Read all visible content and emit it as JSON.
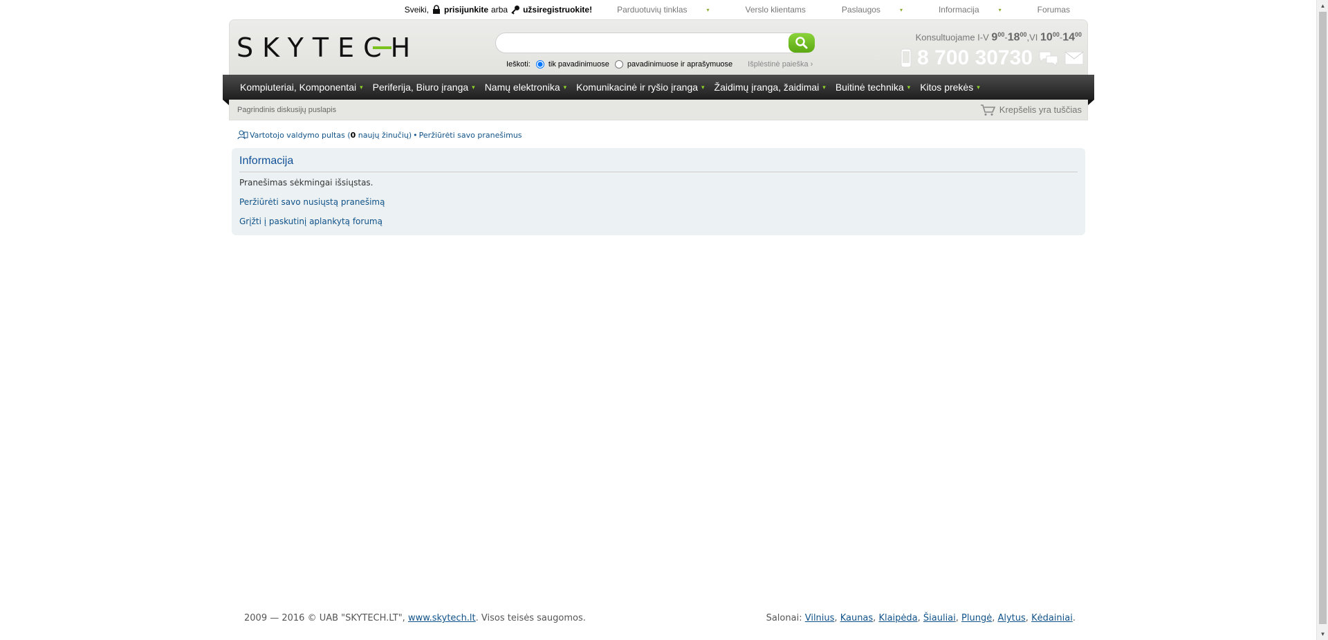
{
  "topbar": {
    "greeting": "Sveiki,",
    "login": "prisijunkite",
    "or": "arba",
    "register": "užsiregistruokite!",
    "links": [
      {
        "label": "Parduotuvių tinklas",
        "caret": true
      },
      {
        "label": "Verslo klientams",
        "caret": false
      },
      {
        "label": "Paslaugos",
        "caret": true
      },
      {
        "label": "Informacija",
        "caret": true
      },
      {
        "label": "Forumas",
        "caret": false
      }
    ]
  },
  "header": {
    "logo": "SKYTECH",
    "search": {
      "value": "",
      "search_in": "Ieškoti:",
      "option_titles": "tik pavadinimuose",
      "option_descriptions": "pavadinimuose ir aprašymuose",
      "selected": "tik pavadinimuose",
      "advanced": "Išplėstinė paieška ›"
    },
    "consult": {
      "prefix": "Konsultuojame I-V",
      "weekday_from": "9",
      "weekday_from_sup": "00",
      "weekday_to": "18",
      "weekday_to_sup": "00",
      "sat_label": ",VI",
      "sat_from": "10",
      "sat_from_sup": "00",
      "sat_to": "14",
      "sat_to_sup": "00"
    },
    "phone": "8 700 30730"
  },
  "nav": [
    "Kompiuteriai, Komponentai",
    "Periferija, Biuro įranga",
    "Namų elektronika",
    "Komunikacinė ir ryšio įranga",
    "Žaidimų įranga, žaidimai",
    "Buitinė technika",
    "Kitos prekės"
  ],
  "subbar": {
    "breadcrumb": "Pagrindinis diskusijų puslapis",
    "cart": "Krepšelis yra tuščias"
  },
  "forum": {
    "ucp_label": "Vartotojo valdymo pultas (",
    "new_messages": "0",
    "new_messages_suffix": " naujų žinučių)",
    "separator": " • ",
    "view_messages": "Peržiūrėti savo pranešimus",
    "panel_title": "Informacija",
    "message": "Pranešimas sėkmingai išsiųstas.",
    "link_view_sent": "Peržiūrėti savo nusiųstą pranešimą",
    "link_back": "Grįžti į paskutinį aplankytą forumą"
  },
  "footer": {
    "copyright_prefix": "2009 — 2016 © UAB \"SKYTECH.LT\", ",
    "site_link": "www.skytech.lt",
    "copyright_suffix": ". Visos teisės saugomos.",
    "salons_label": "Salonai: ",
    "salons": [
      "Vilnius",
      "Kaunas",
      "Klaipėda",
      "Šiauliai",
      "Plungė",
      "Alytus",
      "Kėdainiai"
    ]
  },
  "colors": {
    "accent_green": "#7bc21f",
    "nav_dark": "#2a2a2a",
    "link_blue": "#105289",
    "panel_bg": "#ecf1f3"
  }
}
